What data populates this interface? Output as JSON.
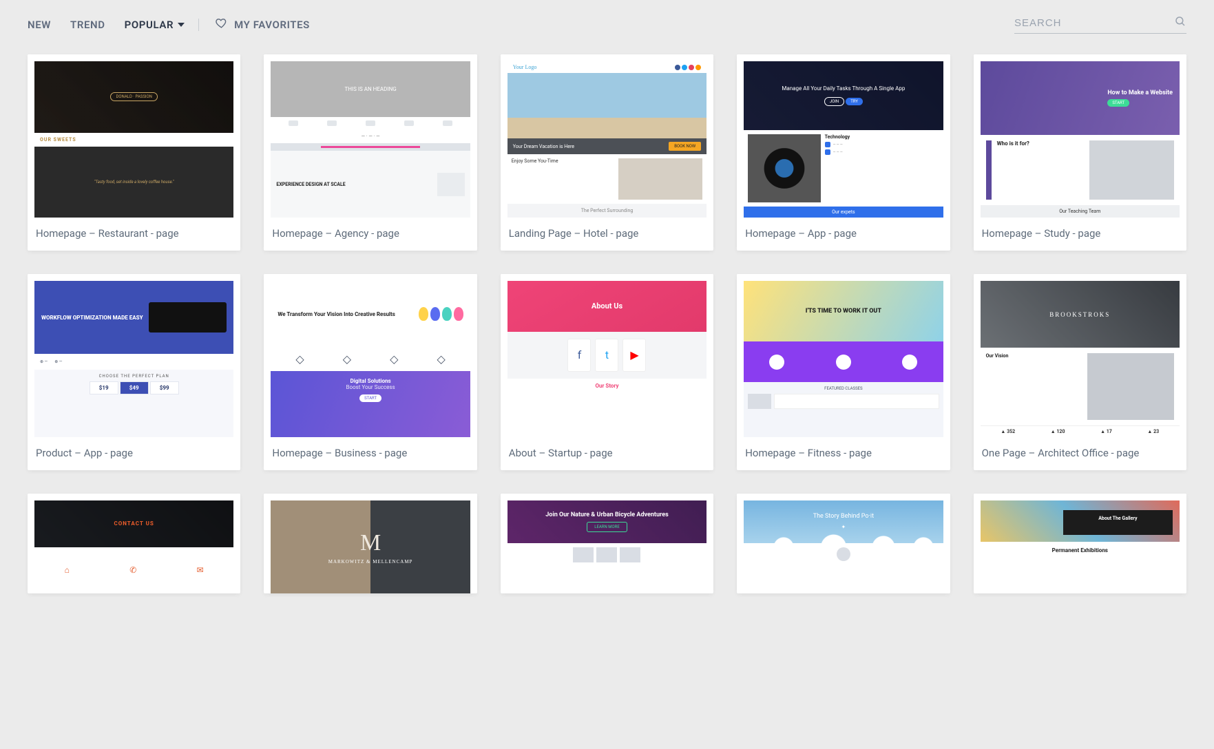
{
  "nav": {
    "filters": [
      "NEW",
      "TREND",
      "POPULAR"
    ],
    "active_filter": "POPULAR",
    "favorites_label": "MY FAVORITES"
  },
  "search": {
    "placeholder": "SEARCH"
  },
  "templates": [
    {
      "id": "restaurant",
      "title": "Homepage – Restaurant - page",
      "thumb": {
        "sweets": "OUR SWEETS",
        "tagline": "\"Tasty food, set inside a lovely coffee house.\""
      }
    },
    {
      "id": "agency",
      "title": "Homepage – Agency - page",
      "thumb": {
        "heading": "THIS IS AN HEADING",
        "exp_title": "EXPERIENCE DESIGN AT SCALE"
      }
    },
    {
      "id": "hotel",
      "title": "Landing Page – Hotel - page",
      "thumb": {
        "logo": "Your Logo",
        "caption": "Your Dream Vacation is Here",
        "cta": "BOOK NOW",
        "enjoy": "Enjoy Some You-Time",
        "surround": "The Perfect Surrounding"
      }
    },
    {
      "id": "app",
      "title": "Homepage – App - page",
      "thumb": {
        "heading": "Manage All Your Daily Tasks Through A Single App",
        "tech": "Technology",
        "foot": "Our expets"
      }
    },
    {
      "id": "study",
      "title": "Homepage – Study - page",
      "thumb": {
        "heading": "How to Make a Website",
        "who": "Who is it for?",
        "team": "Our Teaching Team"
      }
    },
    {
      "id": "product",
      "title": "Product – App - page",
      "thumb": {
        "heading": "WORKFLOW OPTIMIZATION MADE EASY",
        "plan": "CHOOSE THE PERFECT PLAN",
        "prices": [
          "$19",
          "$49",
          "$99"
        ]
      }
    },
    {
      "id": "business",
      "title": "Homepage – Business - page",
      "thumb": {
        "heading": "We Transform Your Vision Into Creative Results",
        "grad_title": "Digital Solutions",
        "grad_sub": "Boost Your Success"
      }
    },
    {
      "id": "startup",
      "title": "About – Startup - page",
      "thumb": {
        "heading": "About Us",
        "socials": [
          "Facebook",
          "Twitter",
          "YouTube"
        ],
        "story": "Our Story"
      }
    },
    {
      "id": "fitness",
      "title": "Homepage – Fitness - page",
      "thumb": {
        "heading": "I'TS TIME TO WORK IT OUT",
        "classes": "FEATURED CLASSES"
      }
    },
    {
      "id": "architect",
      "title": "One Page – Architect Office - page",
      "thumb": {
        "brand": "BROOKSTROKS",
        "vision": "Our Vision",
        "stats": [
          "352",
          "120",
          "17",
          "23"
        ]
      }
    },
    {
      "id": "contact",
      "title": "",
      "thumb": {
        "heading": "CONTACT US"
      }
    },
    {
      "id": "law",
      "title": "",
      "thumb": {
        "firm": "MARKOWITZ & MELLENCAMP"
      }
    },
    {
      "id": "bike",
      "title": "",
      "thumb": {
        "heading": "Join Our Nature & Urban Bicycle Adventures",
        "cta": "LEARN MORE"
      }
    },
    {
      "id": "story",
      "title": "",
      "thumb": {
        "heading": "The Story Behind Po·it"
      }
    },
    {
      "id": "gallery",
      "title": "",
      "thumb": {
        "panel": "About The Gallery",
        "perm": "Permanent Exhibitions"
      }
    }
  ]
}
